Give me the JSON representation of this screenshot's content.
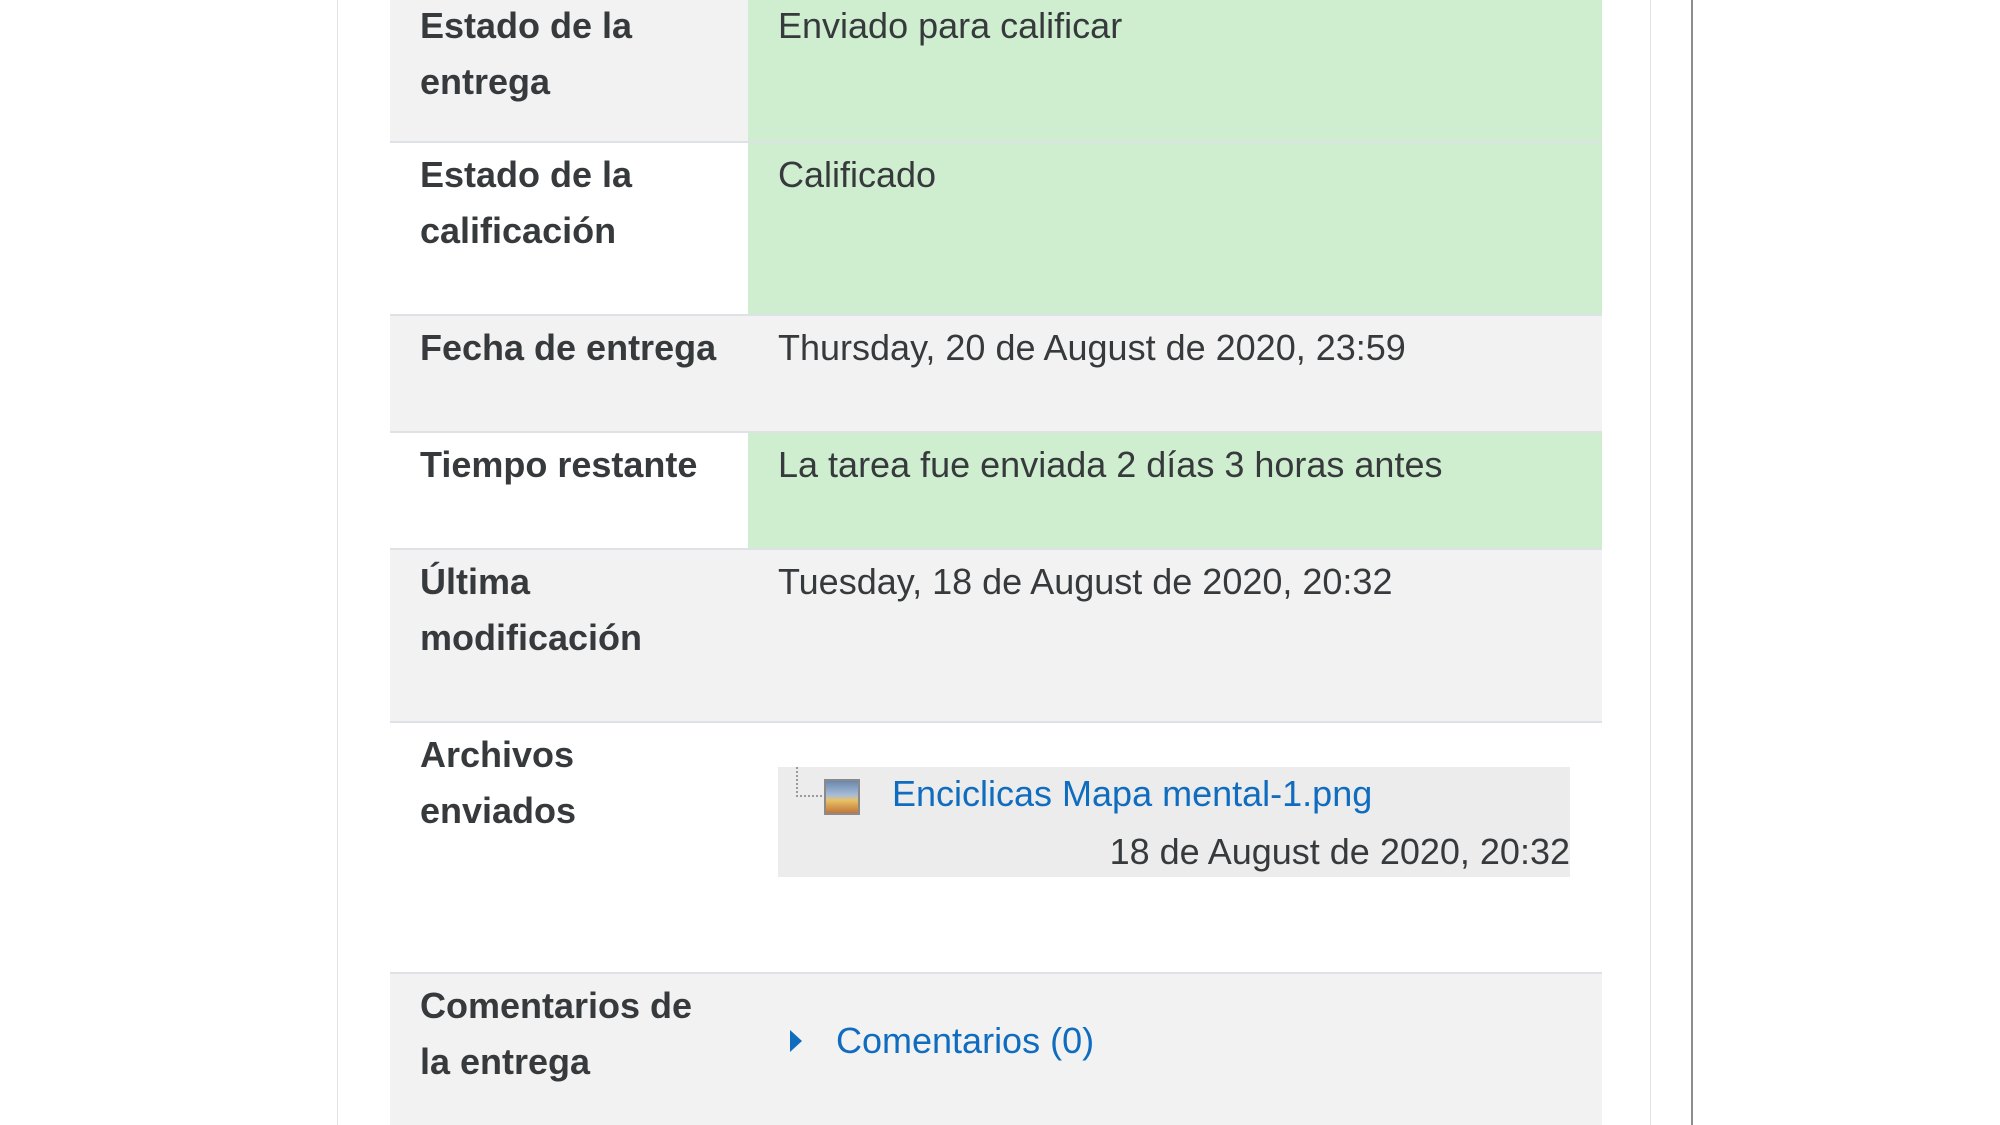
{
  "submission_status": {
    "rows": [
      {
        "label": "Estado de la entrega",
        "value": "Enviado para calificar"
      },
      {
        "label": "Estado de la calificación",
        "value": "Calificado"
      },
      {
        "label": "Fecha de entrega",
        "value": "Thursday, 20 de August de 2020, 23:59"
      },
      {
        "label": "Tiempo restante",
        "value": "La tarea fue enviada 2 días 3 horas antes"
      },
      {
        "label": "Última modificación",
        "value": "Tuesday, 18 de August de 2020, 20:32"
      },
      {
        "label": "Archivos enviados"
      },
      {
        "label": "Comentarios de la entrega"
      }
    ],
    "file": {
      "name": "Enciclicas Mapa mental-1.png",
      "date": "18 de August de 2020, 20:32",
      "icon": "image-file-icon"
    },
    "comments": {
      "label": "Comentarios (0)",
      "icon": "caret-right-icon"
    }
  },
  "colors": {
    "success_bg": "#cfeecf",
    "link": "#0f6cbf"
  }
}
